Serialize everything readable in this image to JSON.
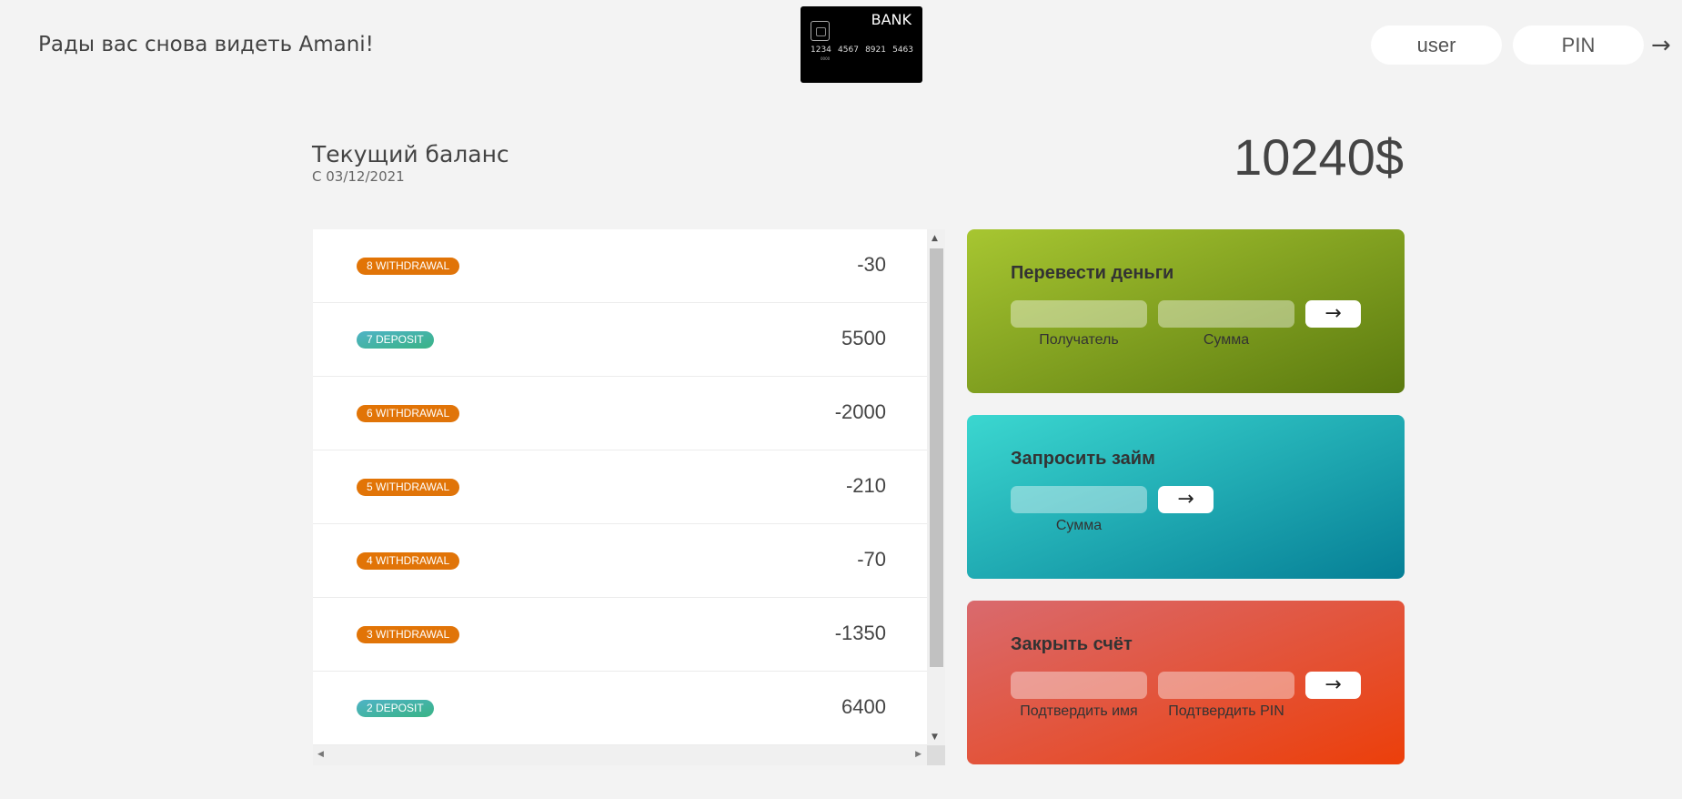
{
  "nav": {
    "welcome": "Рады вас снова видеть Amani!",
    "logo": {
      "brand": "BANK",
      "numbers": [
        "1234",
        "4567",
        "8921",
        "5463"
      ],
      "sub": "0000"
    },
    "login": {
      "user_placeholder": "user",
      "pin_placeholder": "PIN",
      "submit_label": "→"
    }
  },
  "balance": {
    "label": "Текущий баланс",
    "date": "С 03/12/2021",
    "value": "10240$"
  },
  "movements": [
    {
      "type_label": "8 withdrawal",
      "kind": "withdrawal",
      "value": "-30"
    },
    {
      "type_label": "7 deposit",
      "kind": "deposit",
      "value": "5500"
    },
    {
      "type_label": "6 withdrawal",
      "kind": "withdrawal",
      "value": "-2000"
    },
    {
      "type_label": "5 withdrawal",
      "kind": "withdrawal",
      "value": "-210"
    },
    {
      "type_label": "4 withdrawal",
      "kind": "withdrawal",
      "value": "-70"
    },
    {
      "type_label": "3 withdrawal",
      "kind": "withdrawal",
      "value": "-1350"
    },
    {
      "type_label": "2 deposit",
      "kind": "deposit",
      "value": "6400"
    }
  ],
  "operations": {
    "transfer": {
      "title": "Перевести деньги",
      "to_label": "Получатель",
      "amount_label": "Сумма",
      "button": "→"
    },
    "loan": {
      "title": "Запросить займ",
      "amount_label": "Сумма",
      "button": "→"
    },
    "close": {
      "title": "Закрыть счёт",
      "user_label": "Подтвердить имя",
      "pin_label": "Подтвердить PIN",
      "button": "→"
    }
  },
  "colors": {
    "background": "#f3f3f3",
    "withdrawal": "#e0740a",
    "deposit": "#54b6cc",
    "transfer": "#8bac23",
    "loan": "#23b5be",
    "close": "#e2502c"
  }
}
